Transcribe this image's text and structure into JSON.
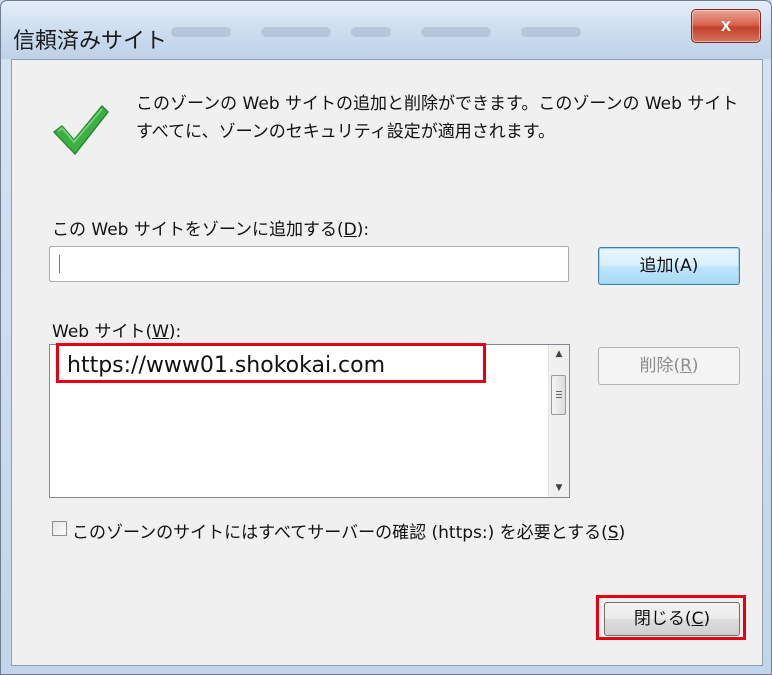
{
  "window": {
    "title": "信頼済みサイト",
    "close_glyph": "x"
  },
  "info": {
    "line1": "このゾーンの Web サイトの追加と削除ができます。このゾーンの Web サイト",
    "line2": "すべてに、ゾーンのセキュリティ設定が適用されます。",
    "icon": "green-checkmark-icon",
    "icon_color": "#3cb043"
  },
  "add_section": {
    "label_pre": "この Web サイトをゾーンに追加する(",
    "label_key": "D",
    "label_post": "):",
    "input_value": "",
    "add_button": "追加(A)"
  },
  "websites": {
    "label_pre": "Web サイト(",
    "label_key": "W",
    "label_post": "):",
    "items": [
      "https://www01.shokokai.com"
    ],
    "delete_pre": "削除(",
    "delete_key": "R",
    "delete_post": ")"
  },
  "require_https": {
    "checked": false,
    "label_pre": "このゾーンのサイトにはすべてサーバーの確認 (https:) を必要とする(",
    "label_key": "S",
    "label_post": ")"
  },
  "footer": {
    "close_pre": "閉じる(",
    "close_key": "C",
    "close_post": ")"
  },
  "colors": {
    "highlight": "#e60012",
    "titlebar": "#cfdff0",
    "close_button": "#c2402a"
  }
}
